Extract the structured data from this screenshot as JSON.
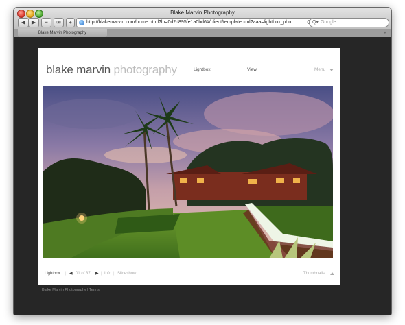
{
  "window": {
    "title": "Blake Marvin Photography"
  },
  "toolbar": {
    "back_label": "◀",
    "forward_label": "▶",
    "history_label": "≡",
    "mail_label": "✉",
    "add_label": "+",
    "url": "http://blakemarvin.com/home.html?lb=0d2d895fe1a0bd6#/client/template.xml?aaa=lightbox_pho",
    "reload_label": "C",
    "search_icon": "Q▾",
    "search_placeholder": "Google"
  },
  "tabs": [
    {
      "label": "Blake Marvin Photography"
    }
  ],
  "tab_add_label": "+",
  "site": {
    "logo_part1": "blake marvin ",
    "logo_part2": "photography",
    "nav": {
      "lightbox": "Lightbox",
      "view": "View",
      "menu": "Menu"
    }
  },
  "bottom_bar": {
    "lightbox": "Lightbox",
    "separator": "|",
    "prev": "◀",
    "counter": "01 of 37",
    "next": "▶",
    "info": "Info",
    "slideshow": "Slideshow",
    "thumbnails": "Thumbnails"
  },
  "footer": {
    "name": "Blake Marvin Photography",
    "separator": " | ",
    "terms": "Terms"
  }
}
